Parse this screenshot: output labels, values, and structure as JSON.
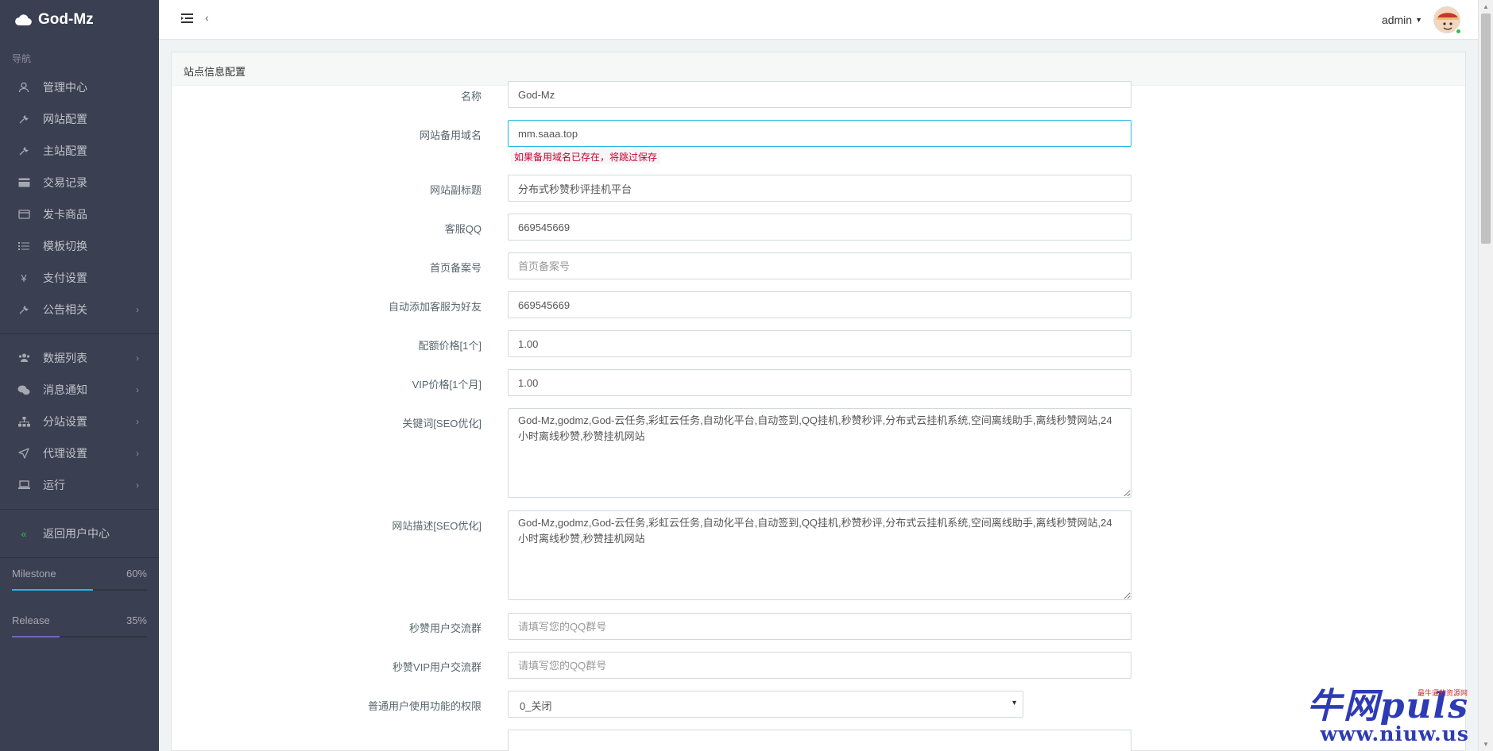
{
  "brand": {
    "name": "God-Mz"
  },
  "sidebar": {
    "header": "导航",
    "items": [
      {
        "label": "管理中心",
        "icon": "user-icon",
        "chev": ""
      },
      {
        "label": "网站配置",
        "icon": "wrench-icon",
        "chev": ""
      },
      {
        "label": "主站配置",
        "icon": "wrench-icon",
        "chev": ""
      },
      {
        "label": "交易记录",
        "icon": "credit-card-icon",
        "chev": ""
      },
      {
        "label": "发卡商品",
        "icon": "card-icon",
        "chev": ""
      },
      {
        "label": "模板切换",
        "icon": "list-icon",
        "chev": ""
      },
      {
        "label": "支付设置",
        "icon": "yen-icon",
        "chev": ""
      },
      {
        "label": "公告相关",
        "icon": "wrench-icon",
        "chev": "›"
      }
    ],
    "items2": [
      {
        "label": "数据列表",
        "icon": "users-icon",
        "chev": "›"
      },
      {
        "label": "消息通知",
        "icon": "wechat-icon",
        "chev": "›"
      },
      {
        "label": "分站设置",
        "icon": "sitemap-icon",
        "chev": "›"
      },
      {
        "label": "代理设置",
        "icon": "send-icon",
        "chev": "›"
      },
      {
        "label": "运行",
        "icon": "laptop-icon",
        "chev": "›"
      }
    ],
    "back": {
      "label": "返回用户中心",
      "icon": "double-chevron-left-icon"
    },
    "progress": [
      {
        "label": "Milestone",
        "percent_text": "60%",
        "value": 0.6,
        "color": "#23b7e5"
      },
      {
        "label": "Release",
        "percent_text": "35%",
        "value": 0.35,
        "color": "#7266ba"
      }
    ]
  },
  "topbar": {
    "user": "admin"
  },
  "panel": {
    "title": "站点信息配置",
    "fields": {
      "name": {
        "label": "名称",
        "value": "God-Mz"
      },
      "backup_domain": {
        "label": "网站备用域名",
        "value": "mm.saaa.top",
        "help": "如果备用域名已存在，将跳过保存"
      },
      "subtitle": {
        "label": "网站副标题",
        "value": "分布式秒赞秒评挂机平台"
      },
      "qq": {
        "label": "客服QQ",
        "value": "669545669"
      },
      "icp": {
        "label": "首页备案号",
        "placeholder": "首页备案号"
      },
      "auto_friend": {
        "label": "自动添加客服为好友",
        "value": "669545669"
      },
      "quota_price": {
        "label": "配额价格[1个]",
        "value": "1.00"
      },
      "vip_price": {
        "label": "VIP价格[1个月]",
        "value": "1.00"
      },
      "keywords": {
        "label": "关键词[SEO优化]",
        "value": "God-Mz,godmz,God-云任务,彩虹云任务,自动化平台,自动签到,QQ挂机,秒赞秒评,分布式云挂机系统,空间离线助手,离线秒赞网站,24小时离线秒赞,秒赞挂机网站"
      },
      "description": {
        "label": "网站描述[SEO优化]",
        "value": "God-Mz,godmz,God-云任务,彩虹云任务,自动化平台,自动签到,QQ挂机,秒赞秒评,分布式云挂机系统,空间离线助手,离线秒赞网站,24小时离线秒赞,秒赞挂机网站"
      },
      "user_group": {
        "label": "秒赞用户交流群",
        "placeholder": "请填写您的QQ群号"
      },
      "vip_group": {
        "label": "秒赞VIP用户交流群",
        "placeholder": "请填写您的QQ群号"
      },
      "permission": {
        "label": "普通用户使用功能的权限",
        "value": "0_关闭"
      }
    }
  },
  "watermark": {
    "top": "牛网puls",
    "tag": "最牛逼的资源网",
    "bottom": "www.niuw.us"
  }
}
